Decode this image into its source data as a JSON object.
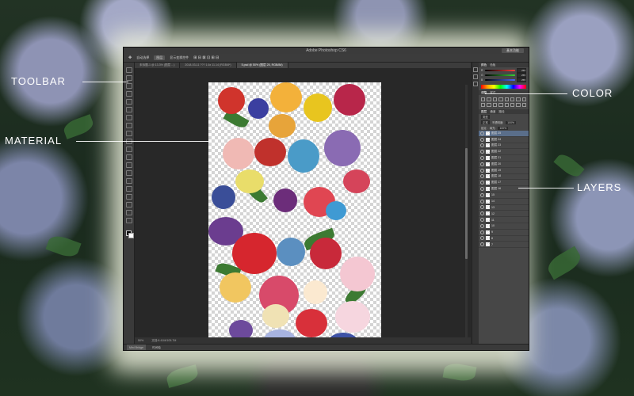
{
  "window": {
    "title": "Adobe Photoshop CS6",
    "workspace": "基本功能"
  },
  "options_bar": {
    "auto_select": "自动选择",
    "target": "图层",
    "show_transform": "显示变换控件"
  },
  "doc_tabs": [
    {
      "label": "未标题-1 @ 13.3% (图层 ...)",
      "active": false
    },
    {
      "label": "2018-03-11 ??? 1.6x 11.14 (RGB/8*)",
      "active": false
    },
    {
      "label": "5.psd @ 50% (图层 25, RGB/8#)",
      "active": true
    }
  ],
  "doc_status": {
    "zoom": "50%",
    "info": "文档:8.41M/105.7M"
  },
  "bottom_tabs": {
    "mini_bridge": "Mini Bridge",
    "timeline": "时间轴"
  },
  "color_panel": {
    "tabs": [
      "颜色",
      "色板"
    ],
    "channels": [
      {
        "label": "R",
        "value": "255",
        "color": "#ff3c3c"
      },
      {
        "label": "G",
        "value": "255",
        "color": "#36d136"
      },
      {
        "label": "B",
        "value": "255",
        "color": "#4a6bff"
      }
    ]
  },
  "adjust_panel": {
    "tabs": [
      "调整",
      "样式"
    ]
  },
  "layers_panel": {
    "tabs": [
      "图层",
      "通道",
      "路径"
    ],
    "kind": "类型",
    "blend": "正常",
    "opacity_label": "不透明度:",
    "opacity": "100%",
    "lock_label": "锁定:",
    "fill_label": "填充:",
    "fill": "100%",
    "layers": [
      {
        "name": "图层 25",
        "selected": true
      },
      {
        "name": "图层 24",
        "selected": false
      },
      {
        "name": "图层 23",
        "selected": false
      },
      {
        "name": "图层 22",
        "selected": false
      },
      {
        "name": "图层 21",
        "selected": false
      },
      {
        "name": "图层 20",
        "selected": false
      },
      {
        "name": "图层 19",
        "selected": false
      },
      {
        "name": "图层 18",
        "selected": false
      },
      {
        "name": "图层 17",
        "selected": false
      },
      {
        "name": "图层 16",
        "selected": false
      },
      {
        "name": "15",
        "selected": false
      },
      {
        "name": "14",
        "selected": false
      },
      {
        "name": "13",
        "selected": false
      },
      {
        "name": "12",
        "selected": false
      },
      {
        "name": "11",
        "selected": false
      },
      {
        "name": "10",
        "selected": false
      },
      {
        "name": "9",
        "selected": false
      },
      {
        "name": "8",
        "selected": false
      },
      {
        "name": "7",
        "selected": false
      }
    ]
  },
  "callouts": {
    "toolbar": "TOOLBAR",
    "material": "MATERIAL",
    "color": "COLOR",
    "layers": "LAYERS"
  }
}
